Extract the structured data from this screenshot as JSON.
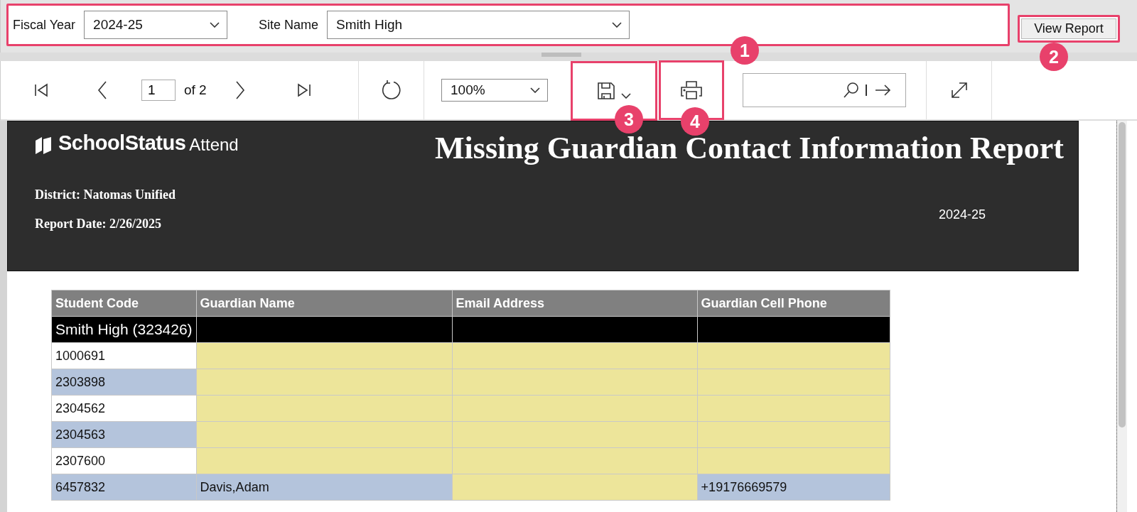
{
  "parameters": {
    "callout": "1",
    "fields": [
      {
        "label": "Fiscal Year",
        "value": "2024-25",
        "kind": "short"
      },
      {
        "label": "Site Name",
        "value": "Smith High",
        "kind": "long"
      }
    ]
  },
  "view_report": {
    "label": "View Report",
    "callout": "2"
  },
  "toolbar": {
    "page": "1",
    "page_count": "of 2",
    "zoom": "100%",
    "save_callout": "3",
    "print_callout": "4"
  },
  "report": {
    "brand": "SchoolStatus",
    "product": "Attend",
    "title": "Missing Guardian Contact Information Report",
    "district": "District: Natomas Unified",
    "report_date": "Report Date: 2/26/2025",
    "fiscal_year": "2024-25",
    "table": {
      "columns": [
        "Student Code",
        "Guardian Name",
        "Email Address",
        "Guardian Cell Phone"
      ],
      "group": "Smith High (323426)",
      "rows": [
        {
          "shaded": false,
          "cells": [
            {
              "text": "1000691"
            },
            {
              "missing": true
            },
            {
              "missing": true
            },
            {
              "missing": true
            }
          ]
        },
        {
          "shaded": true,
          "cells": [
            {
              "text": "2303898"
            },
            {
              "missing": true
            },
            {
              "missing": true
            },
            {
              "missing": true
            }
          ]
        },
        {
          "shaded": false,
          "cells": [
            {
              "text": "2304562"
            },
            {
              "missing": true
            },
            {
              "missing": true
            },
            {
              "missing": true
            }
          ]
        },
        {
          "shaded": true,
          "cells": [
            {
              "text": "2304563"
            },
            {
              "missing": true
            },
            {
              "missing": true
            },
            {
              "missing": true
            }
          ]
        },
        {
          "shaded": false,
          "cells": [
            {
              "text": "2307600"
            },
            {
              "missing": true
            },
            {
              "missing": true
            },
            {
              "missing": true
            }
          ]
        },
        {
          "shaded": true,
          "cells": [
            {
              "text": "6457832"
            },
            {
              "text": "Davis,Adam"
            },
            {
              "missing": true
            },
            {
              "text": "+19176669579"
            }
          ]
        }
      ]
    }
  }
}
